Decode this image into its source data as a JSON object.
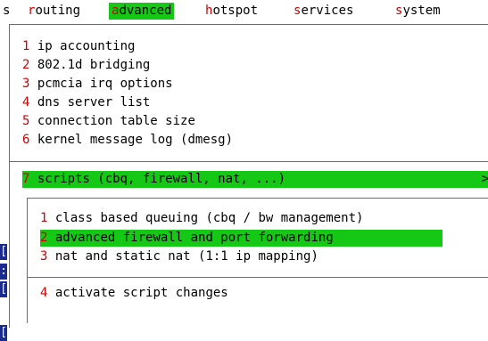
{
  "menubar": {
    "edge_glyph": "s",
    "items": [
      {
        "hot": "r",
        "rest": "outing"
      },
      {
        "hot": "a",
        "rest": "dvanced"
      },
      {
        "hot": "h",
        "rest": "otspot"
      },
      {
        "hot": "s",
        "rest": "ervices"
      },
      {
        "hot": "s",
        "rest": "ystem"
      }
    ]
  },
  "advanced_menu": {
    "items": [
      {
        "num": "1",
        "label": " ip accounting"
      },
      {
        "num": "2",
        "label": " 802.1d bridging"
      },
      {
        "num": "3",
        "label": " pcmcia irq options"
      },
      {
        "num": "4",
        "label": " dns server list"
      },
      {
        "num": "5",
        "label": " connection table size"
      },
      {
        "num": "6",
        "label": " kernel message log (dmesg)"
      }
    ],
    "scripts": {
      "num": "7",
      "label": " scripts (cbq, firewall, nat, ...)",
      "arrow": ">"
    }
  },
  "scripts_submenu": {
    "items": [
      {
        "num": "1",
        "label": " class based queuing (cbq / bw management)"
      },
      {
        "num": "2",
        "label": " advanced firewall and port forwarding"
      },
      {
        "num": "3",
        "label": " nat and static nat (1:1 ip mapping)"
      }
    ],
    "activate": {
      "num": "4",
      "label": " activate script changes"
    }
  },
  "left_edge": {
    "marks": [
      "[",
      ":",
      "[",
      "["
    ]
  },
  "colors": {
    "selected_bg": "#15c815",
    "hotkey": "#cc0000",
    "frame": "#6e6e6e",
    "edge": "#1b2a8f"
  }
}
